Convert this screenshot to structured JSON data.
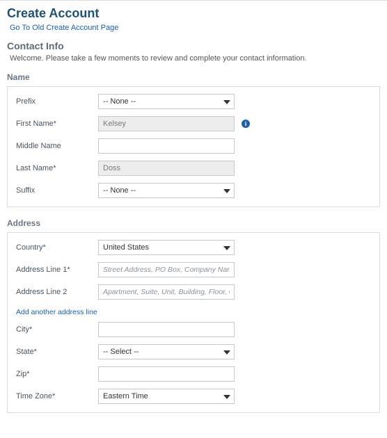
{
  "header": {
    "title": "Create Account",
    "old_link": "Go To Old Create Account Page"
  },
  "contact_info": {
    "heading": "Contact Info",
    "welcome": "Welcome. Please take a few moments to review and complete your contact information."
  },
  "name_section": {
    "heading": "Name",
    "labels": {
      "prefix": "Prefix",
      "first_name": "First Name*",
      "middle_name": "Middle Name",
      "last_name": "Last Name*",
      "suffix": "Suffix"
    },
    "values": {
      "prefix": "-- None --",
      "first_name": "Kelsey",
      "middle_name": "",
      "last_name": "Doss",
      "suffix": "-- None --"
    },
    "info_glyph": "i"
  },
  "address_section": {
    "heading": "Address",
    "labels": {
      "country": "Country*",
      "line1": "Address Line 1*",
      "line2": "Address Line 2",
      "city": "City*",
      "state": "State*",
      "zip": "Zip*",
      "time_zone": "Time Zone*"
    },
    "values": {
      "country": "United States",
      "line1": "",
      "line2": "",
      "city": "",
      "state": "-- Select --",
      "zip": "",
      "time_zone": "Eastern Time"
    },
    "placeholders": {
      "line1": "Street Address, PO Box, Company Name, c/",
      "line2": "Apartment, Suite, Unit, Building, Floor, etc."
    },
    "add_line": "Add another address line"
  }
}
